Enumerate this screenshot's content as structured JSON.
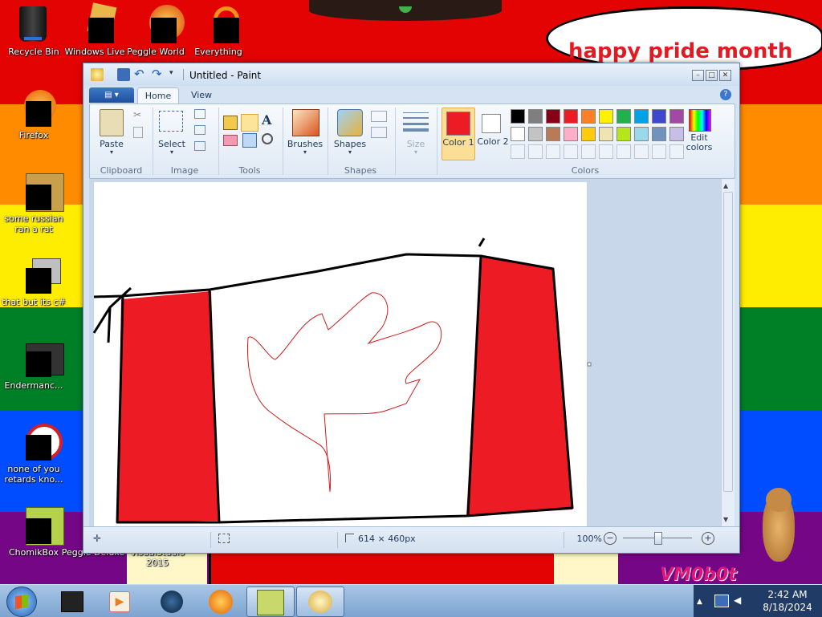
{
  "desktop": {
    "icons": [
      {
        "label": "Recycle Bin"
      },
      {
        "label": "Windows Live"
      },
      {
        "label": "Peggle World"
      },
      {
        "label": "Everything"
      },
      {
        "label": "Firefox"
      },
      {
        "label": "some russian ran a rat"
      },
      {
        "label": "that but its c#"
      },
      {
        "label": "Endermanc..."
      },
      {
        "label": "none of you retards kno..."
      },
      {
        "label": "ChomikBox"
      },
      {
        "label": "Peggle Deluxe"
      },
      {
        "label": "VisualStudio 2015"
      }
    ],
    "speech_bubble": "happy pride month",
    "watermark": "VM0b0t"
  },
  "paint": {
    "title": "Untitled - Paint",
    "tabs": {
      "file": "",
      "home": "Home",
      "view": "View"
    },
    "groups": {
      "clipboard": {
        "label": "Clipboard",
        "paste": "Paste"
      },
      "image": {
        "label": "Image",
        "select": "Select"
      },
      "tools": {
        "label": "Tools"
      },
      "brushes": {
        "label": "Brushes"
      },
      "shapes": {
        "label": "Shapes",
        "button": "Shapes"
      },
      "size": {
        "label": "Size"
      },
      "colors": {
        "label": "Colors",
        "color1": "Color 1",
        "color2": "Color 2",
        "edit": "Edit colors",
        "color1_value": "#ed1c24",
        "color2_value": "#ffffff",
        "palette_row1": [
          "#000000",
          "#7f7f7f",
          "#880015",
          "#ed1c24",
          "#ff7f27",
          "#fff200",
          "#22b14c",
          "#00a2e8",
          "#3f48cc",
          "#a349a4"
        ],
        "palette_row2": [
          "#ffffff",
          "#c3c3c3",
          "#b97a57",
          "#ffaec9",
          "#ffc90e",
          "#efe4b0",
          "#b5e61d",
          "#99d9ea",
          "#7092be",
          "#c8bfe7"
        ]
      }
    },
    "status": {
      "dimensions": "614 × 460px",
      "zoom": "100%"
    }
  },
  "taskbar": {
    "time": "2:42 AM",
    "date": "8/18/2024"
  }
}
